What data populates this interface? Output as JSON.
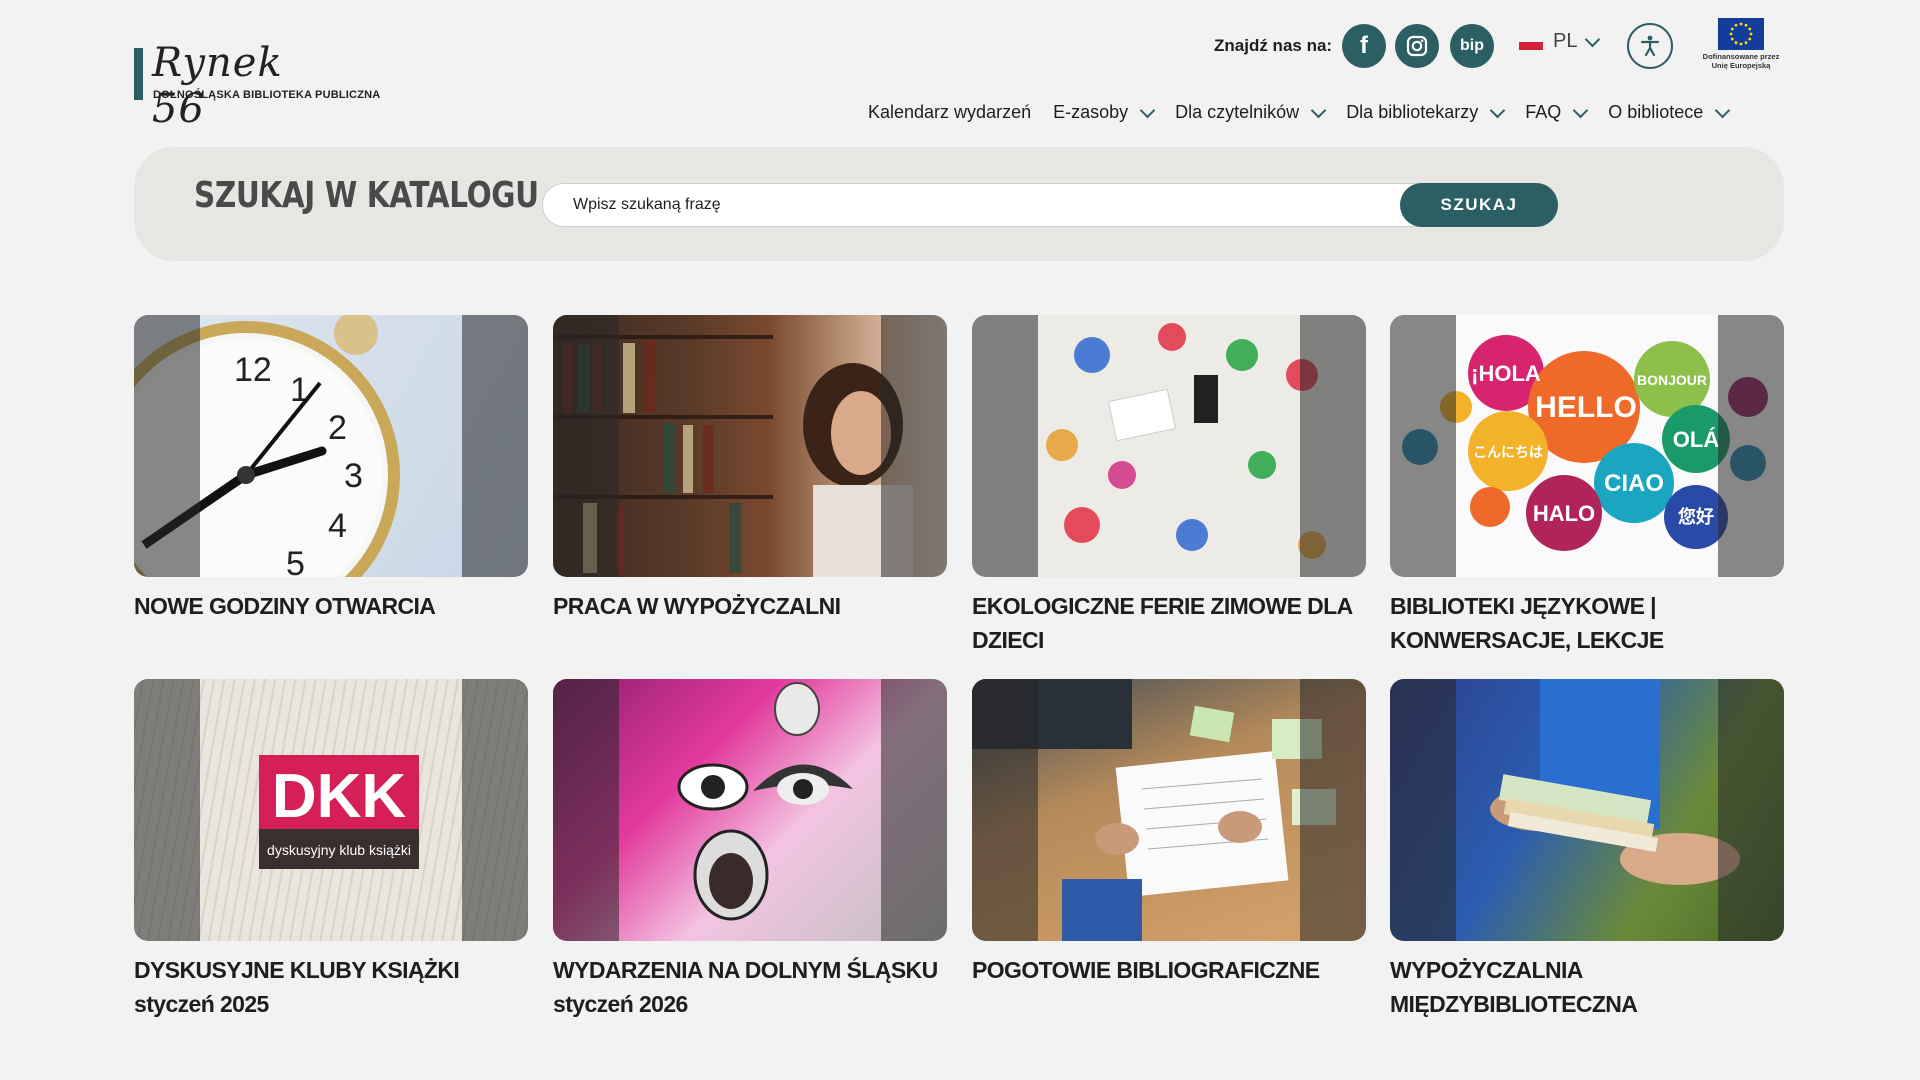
{
  "logo": {
    "wordmark": "Rynek 56",
    "subtitle": "DOLNOŚLĄSKA BIBLIOTEKA PUBLICZNA"
  },
  "header": {
    "find_us_label": "Znajdź nas na:",
    "social": [
      {
        "name": "facebook-icon",
        "glyph": "f"
      },
      {
        "name": "instagram-icon",
        "glyph": ""
      },
      {
        "name": "bip-icon",
        "glyph": "bip"
      }
    ],
    "language": "PL",
    "eu_caption": "Dofinansowane przez Unię Europejską"
  },
  "nav": {
    "items": [
      {
        "label": "Kalendarz wydarzeń",
        "dropdown": false
      },
      {
        "label": "E-zasoby",
        "dropdown": true
      },
      {
        "label": "Dla czytelników",
        "dropdown": true
      },
      {
        "label": "Dla bibliotekarzy",
        "dropdown": true
      },
      {
        "label": "FAQ",
        "dropdown": true
      },
      {
        "label": "O bibliotece",
        "dropdown": true
      }
    ]
  },
  "search": {
    "title": "SZUKAJ W KATALOGU",
    "placeholder": "Wpisz szukaną frazę",
    "button": "SZUKAJ"
  },
  "tiles": [
    {
      "title": "NOWE GODZINY OTWARCIA"
    },
    {
      "title": "PRACA W WYPOŻYCZALNI"
    },
    {
      "title": "EKOLOGICZNE FERIE ZIMOWE DLA DZIECI"
    },
    {
      "title": "BIBLIOTEKI JĘZYKOWE | KONWERSACJE, LEKCJE"
    },
    {
      "title": "DYSKUSYJNE KLUBY KSIĄŻKI styczeń 2025"
    },
    {
      "title": "WYDARZENIA NA DOLNYM ŚLĄSKU styczeń 2026"
    },
    {
      "title": "POGOTOWIE BIBLIOGRAFICZNE"
    },
    {
      "title": "WYPOŻYCZALNIA MIĘDZYBIBLIOTECZNA"
    }
  ],
  "tile_images": {
    "languages_bubbles": [
      "¡HOLA",
      "HELLO",
      "BONJOUR",
      "OLÁ",
      "こんにちは",
      "CIAO",
      "HALO",
      "您好"
    ],
    "dkk_logo": "DKK",
    "dkk_caption": "dyskusyjny klub książki"
  },
  "colors": {
    "accent": "#2b5f63",
    "background": "#f2f2f2",
    "search_panel": "#e6e6e3"
  }
}
